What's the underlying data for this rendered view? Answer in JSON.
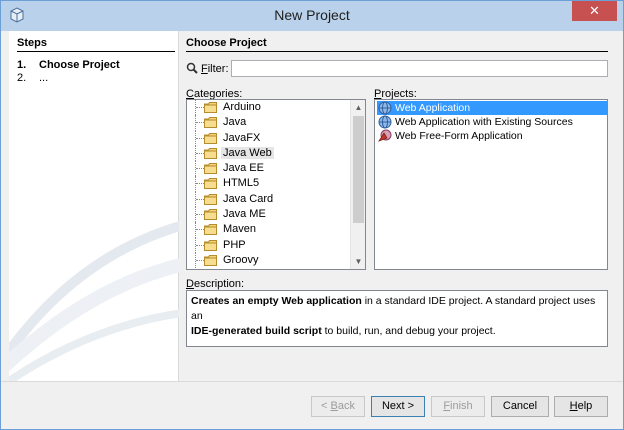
{
  "window": {
    "title": "New Project",
    "close_glyph": "✕"
  },
  "steps": {
    "header": "Steps",
    "items": [
      {
        "num": "1.",
        "label": "Choose Project"
      },
      {
        "num": "2.",
        "label": "..."
      }
    ]
  },
  "content": {
    "header": "Choose Project",
    "filter": {
      "label_u": "F",
      "label_rest": "ilter:",
      "value": ""
    },
    "categories": {
      "label_u": "C",
      "label_rest": "ategories:",
      "items": [
        "Arduino",
        "Java",
        "JavaFX",
        "Java Web",
        "Java EE",
        "HTML5",
        "Java Card",
        "Java ME",
        "Maven",
        "PHP",
        "Groovy"
      ],
      "selected": "Java Web"
    },
    "projects": {
      "label_u": "P",
      "label_rest": "rojects:",
      "items": [
        "Web Application",
        "Web Application with Existing Sources",
        "Web Free-Form Application"
      ],
      "selected": "Web Application"
    },
    "description": {
      "label_u": "D",
      "label_rest": "escription:",
      "bold1": "Creates an empty Web application",
      "text1": " in a standard IDE project. A standard project uses an",
      "bold2": "IDE-generated build script",
      "text2": " to build, run, and debug your project."
    }
  },
  "buttons": {
    "back": {
      "pre": "< ",
      "u": "B",
      "rest": "ack"
    },
    "next": {
      "pre": "Next >",
      "u": "",
      "rest": ""
    },
    "finish": {
      "pre": "",
      "u": "F",
      "rest": "inish"
    },
    "cancel": {
      "pre": "Cancel",
      "u": "",
      "rest": ""
    },
    "help": {
      "pre": "",
      "u": "H",
      "rest": "elp"
    }
  },
  "colors": {
    "titlebar": "#b9d1ea",
    "close": "#c75050",
    "selection": "#3399ff"
  }
}
